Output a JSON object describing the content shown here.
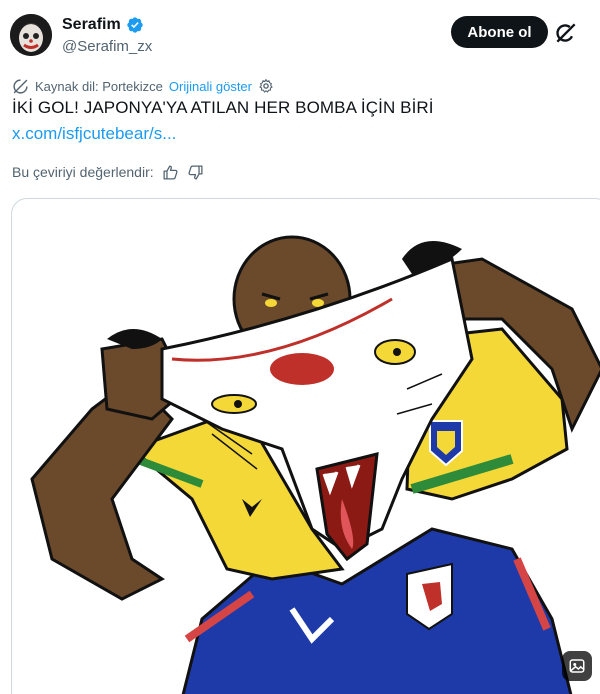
{
  "author": {
    "name": "Serafim",
    "handle": "@Serafim_zx"
  },
  "header": {
    "follow_label": "Abone ol"
  },
  "translation": {
    "source_label": "Kaynak dil: Portekizce",
    "show_original_label": "Orijinali göster"
  },
  "tweet": {
    "text": "İKİ GOL! JAPONYA'YA ATILAN HER BOMBA İÇİN BİRİ",
    "link": "x.com/isfjcutebear/s..."
  },
  "rating": {
    "label": "Bu çeviriyi değerlendir:"
  },
  "colors": {
    "accent": "#1d9bf0",
    "text": "#0f1419",
    "secondary_text": "#536471",
    "verified": "#1d9bf0",
    "brazil_yellow": "#f4d837",
    "brazil_green": "#2e8b3a",
    "japan_blue": "#1e3aa8"
  },
  "icons": [
    "verified-icon",
    "grok-icon",
    "translate-icon",
    "gear-icon",
    "thumbs-up-icon",
    "thumbs-down-icon",
    "alt-text-icon"
  ]
}
